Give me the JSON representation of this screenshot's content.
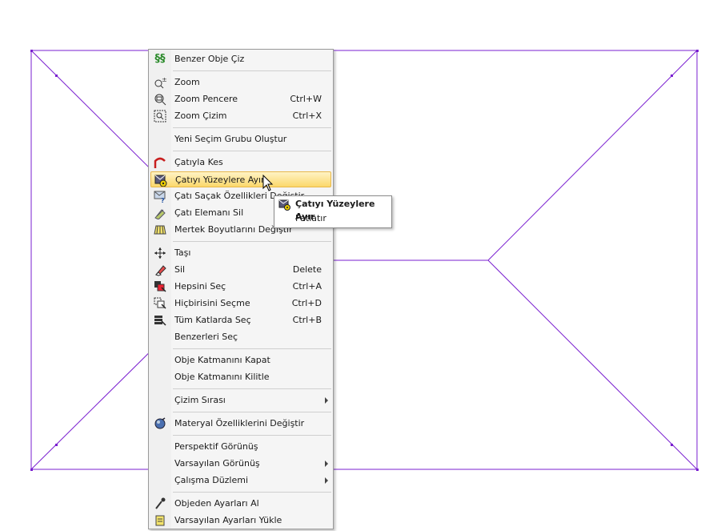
{
  "colors": {
    "drawing_line": "#7a1fd0",
    "highlight": "#fbd86b"
  },
  "menu": {
    "items": [
      {
        "label": "Benzer Obje Çiz",
        "icon": "similar-object-icon"
      },
      {
        "label": "Zoom",
        "icon": "zoom-icon"
      },
      {
        "label": "Zoom Pencere",
        "shortcut": "Ctrl+W",
        "icon": "zoom-window-icon"
      },
      {
        "label": "Zoom Çizim",
        "shortcut": "Ctrl+X",
        "icon": "zoom-drawing-icon"
      },
      {
        "label": "Yeni Seçim Grubu Oluştur"
      },
      {
        "label": "Çatıyla Kes",
        "icon": "roof-cut-icon"
      },
      {
        "label": "Çatıyı Yüzeylere Ayır",
        "icon": "roof-split-icon",
        "highlighted": true
      },
      {
        "label": "Çatı Saçak Özellikleri Değiştir",
        "icon": "roof-eave-icon"
      },
      {
        "label": "Çatı Elemanı Sil",
        "icon": "roof-element-delete-icon"
      },
      {
        "label": "Mertek Boyutlarını Değiştir",
        "icon": "rafter-icon"
      },
      {
        "label": "Taşı",
        "icon": "move-icon"
      },
      {
        "label": "Sil",
        "shortcut": "Delete",
        "icon": "eraser-icon"
      },
      {
        "label": "Hepsini Seç",
        "shortcut": "Ctrl+A",
        "icon": "select-all-icon"
      },
      {
        "label": "Hiçbirisini Seçme",
        "shortcut": "Ctrl+D",
        "icon": "select-none-icon"
      },
      {
        "label": "Tüm Katlarda Seç",
        "shortcut": "Ctrl+B",
        "icon": "select-all-floors-icon"
      },
      {
        "label": "Benzerleri Seç"
      },
      {
        "label": "Obje Katmanını Kapat"
      },
      {
        "label": "Obje Katmanını Kilitle"
      },
      {
        "label": "Çizim Sırası",
        "submenu": true
      },
      {
        "label": "Materyal Özelliklerini Değiştir",
        "icon": "material-icon"
      },
      {
        "label": "Perspektif Görünüş"
      },
      {
        "label": "Varsayılan Görünüş",
        "submenu": true
      },
      {
        "label": "Çalışma Düzlemi",
        "submenu": true
      },
      {
        "label": "Objeden Ayarları Al",
        "icon": "eyedropper-icon"
      },
      {
        "label": "Varsayılan Ayarları Yükle",
        "icon": "load-defaults-icon"
      }
    ]
  },
  "tooltip": {
    "title": "Çatıyı Yüzeylere Ayır",
    "subtitle": "Patlatır"
  }
}
